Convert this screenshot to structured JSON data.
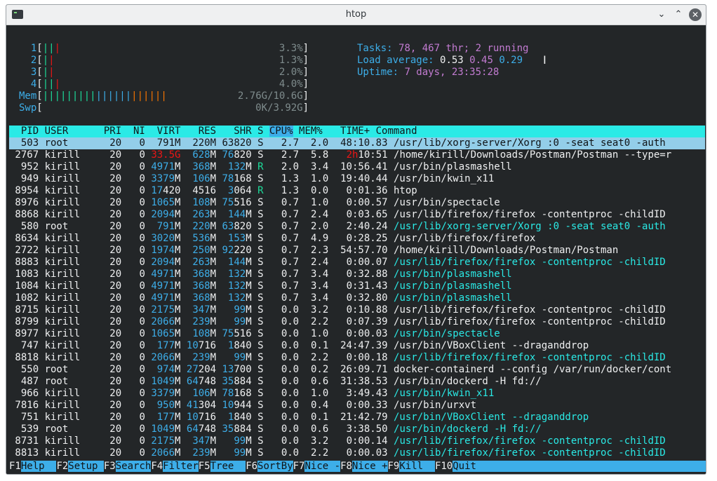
{
  "window": {
    "title": "htop"
  },
  "cpus": [
    {
      "label": "1",
      "pct": "3.3%"
    },
    {
      "label": "2",
      "pct": "1.3%"
    },
    {
      "label": "3",
      "pct": "2.0%"
    },
    {
      "label": "4",
      "pct": "4.0%"
    }
  ],
  "mem": {
    "label": "Mem",
    "value": "2.76G/10.6G"
  },
  "swp": {
    "label": "Swp",
    "value": "0K/3.92G"
  },
  "summary": {
    "tasks_label": "Tasks:",
    "tasks_value": "78, 467 thr; 2 running",
    "load_label": "Load average:",
    "load1": "0.53",
    "load5": "0.45",
    "load15": "0.29",
    "uptime_label": "Uptime:",
    "uptime_value": "7 days, 23:35:28"
  },
  "header": {
    "pid": "PID",
    "user": "USER",
    "pri": "PRI",
    "ni": "NI",
    "virt": "VIRT",
    "res": "RES",
    "shr": "SHR",
    "s": "S",
    "cpu": "CPU%",
    "mem": "MEM%",
    "time": "TIME+",
    "command": "Command"
  },
  "processes": [
    {
      "pid": "503",
      "user": "root",
      "pri": "20",
      "ni": "0",
      "virt": "791M",
      "res": "220M",
      "shr": "63820",
      "s": "S",
      "cpu": "2.7",
      "mem": "2.0",
      "time": "48:10.83",
      "cmd": "/usr/lib/xorg-server/Xorg :0 -seat seat0 -auth",
      "selected": true
    },
    {
      "pid": "2767",
      "user": "kirill",
      "pri": "20",
      "ni": "0",
      "virt": "33.5G",
      "res": "628M",
      "shr": "76820",
      "s": "S",
      "cpu": "2.7",
      "mem": "5.8",
      "time": "2h10:51",
      "cmd": "/home/kirill/Downloads/Postman/Postman --type=r"
    },
    {
      "pid": "952",
      "user": "kirill",
      "pri": "20",
      "ni": "0",
      "virt": "4971M",
      "res": "368M",
      "shr": "132M",
      "s": "R",
      "cpu": "2.0",
      "mem": "3.4",
      "time": "10:56.41",
      "cmd": "/usr/bin/plasmashell"
    },
    {
      "pid": "949",
      "user": "kirill",
      "pri": "20",
      "ni": "0",
      "virt": "3379M",
      "res": "106M",
      "shr": "78168",
      "s": "S",
      "cpu": "1.3",
      "mem": "1.0",
      "time": "19:40.44",
      "cmd": "/usr/bin/kwin_x11"
    },
    {
      "pid": "8954",
      "user": "kirill",
      "pri": "20",
      "ni": "0",
      "virt": "17420",
      "res": "4516",
      "shr": "3064",
      "s": "R",
      "cpu": "1.3",
      "mem": "0.0",
      "time": "0:01.36",
      "cmd": "htop"
    },
    {
      "pid": "8976",
      "user": "kirill",
      "pri": "20",
      "ni": "0",
      "virt": "1065M",
      "res": "108M",
      "shr": "75516",
      "s": "S",
      "cpu": "0.7",
      "mem": "1.0",
      "time": "0:00.57",
      "cmd": "/usr/bin/spectacle"
    },
    {
      "pid": "8868",
      "user": "kirill",
      "pri": "20",
      "ni": "0",
      "virt": "2094M",
      "res": "263M",
      "shr": "144M",
      "s": "S",
      "cpu": "0.7",
      "mem": "2.4",
      "time": "0:03.65",
      "cmd": "/usr/lib/firefox/firefox -contentproc -childID"
    },
    {
      "pid": "580",
      "user": "root",
      "pri": "20",
      "ni": "0",
      "virt": "791M",
      "res": "220M",
      "shr": "63820",
      "s": "S",
      "cpu": "0.7",
      "mem": "2.0",
      "time": "2:40.24",
      "cmd": "/usr/lib/xorg-server/Xorg :0 -seat seat0 -auth",
      "thread": true
    },
    {
      "pid": "8634",
      "user": "kirill",
      "pri": "20",
      "ni": "0",
      "virt": "3020M",
      "res": "536M",
      "shr": "153M",
      "s": "S",
      "cpu": "0.7",
      "mem": "4.9",
      "time": "0:28.25",
      "cmd": "/usr/lib/firefox/firefox"
    },
    {
      "pid": "2722",
      "user": "kirill",
      "pri": "20",
      "ni": "0",
      "virt": "1974M",
      "res": "250M",
      "shr": "92220",
      "s": "S",
      "cpu": "0.7",
      "mem": "2.3",
      "time": "54:57.70",
      "cmd": "/home/kirill/Downloads/Postman/Postman"
    },
    {
      "pid": "8883",
      "user": "kirill",
      "pri": "20",
      "ni": "0",
      "virt": "2094M",
      "res": "263M",
      "shr": "144M",
      "s": "S",
      "cpu": "0.7",
      "mem": "2.4",
      "time": "0:00.07",
      "cmd": "/usr/lib/firefox/firefox -contentproc -childID",
      "thread": true
    },
    {
      "pid": "1083",
      "user": "kirill",
      "pri": "20",
      "ni": "0",
      "virt": "4971M",
      "res": "368M",
      "shr": "132M",
      "s": "S",
      "cpu": "0.7",
      "mem": "3.4",
      "time": "0:32.88",
      "cmd": "/usr/bin/plasmashell",
      "thread": true
    },
    {
      "pid": "1084",
      "user": "kirill",
      "pri": "20",
      "ni": "0",
      "virt": "4971M",
      "res": "368M",
      "shr": "132M",
      "s": "S",
      "cpu": "0.7",
      "mem": "3.4",
      "time": "0:31.43",
      "cmd": "/usr/bin/plasmashell",
      "thread": true
    },
    {
      "pid": "1082",
      "user": "kirill",
      "pri": "20",
      "ni": "0",
      "virt": "4971M",
      "res": "368M",
      "shr": "132M",
      "s": "S",
      "cpu": "0.7",
      "mem": "3.4",
      "time": "0:32.80",
      "cmd": "/usr/bin/plasmashell",
      "thread": true
    },
    {
      "pid": "8715",
      "user": "kirill",
      "pri": "20",
      "ni": "0",
      "virt": "2175M",
      "res": "347M",
      "shr": "99M",
      "s": "S",
      "cpu": "0.0",
      "mem": "3.2",
      "time": "0:10.88",
      "cmd": "/usr/lib/firefox/firefox -contentproc -childID"
    },
    {
      "pid": "8799",
      "user": "kirill",
      "pri": "20",
      "ni": "0",
      "virt": "2066M",
      "res": "239M",
      "shr": "99M",
      "s": "S",
      "cpu": "0.0",
      "mem": "2.2",
      "time": "0:07.39",
      "cmd": "/usr/lib/firefox/firefox -contentproc -childID"
    },
    {
      "pid": "8977",
      "user": "kirill",
      "pri": "20",
      "ni": "0",
      "virt": "1065M",
      "res": "108M",
      "shr": "75516",
      "s": "S",
      "cpu": "0.0",
      "mem": "1.0",
      "time": "0:00.03",
      "cmd": "/usr/bin/spectacle",
      "thread": true
    },
    {
      "pid": "747",
      "user": "kirill",
      "pri": "20",
      "ni": "0",
      "virt": "177M",
      "res": "10716",
      "shr": "1840",
      "s": "S",
      "cpu": "0.0",
      "mem": "0.1",
      "time": "24:47.39",
      "cmd": "/usr/bin/VBoxClient --draganddrop"
    },
    {
      "pid": "8818",
      "user": "kirill",
      "pri": "20",
      "ni": "0",
      "virt": "2066M",
      "res": "239M",
      "shr": "99M",
      "s": "S",
      "cpu": "0.0",
      "mem": "2.2",
      "time": "0:00.18",
      "cmd": "/usr/lib/firefox/firefox -contentproc -childID",
      "thread": true
    },
    {
      "pid": "550",
      "user": "root",
      "pri": "20",
      "ni": "0",
      "virt": "974M",
      "res": "27204",
      "shr": "13700",
      "s": "S",
      "cpu": "0.0",
      "mem": "0.2",
      "time": "26:09.71",
      "cmd": "docker-containerd --config /var/run/docker/cont"
    },
    {
      "pid": "487",
      "user": "root",
      "pri": "20",
      "ni": "0",
      "virt": "1049M",
      "res": "64748",
      "shr": "35884",
      "s": "S",
      "cpu": "0.0",
      "mem": "0.6",
      "time": "31:38.53",
      "cmd": "/usr/bin/dockerd -H fd://"
    },
    {
      "pid": "966",
      "user": "kirill",
      "pri": "20",
      "ni": "0",
      "virt": "3379M",
      "res": "106M",
      "shr": "78168",
      "s": "S",
      "cpu": "0.0",
      "mem": "1.0",
      "time": "3:49.43",
      "cmd": "/usr/bin/kwin_x11",
      "thread": true
    },
    {
      "pid": "7816",
      "user": "kirill",
      "pri": "20",
      "ni": "0",
      "virt": "950M",
      "res": "41304",
      "shr": "10944",
      "s": "S",
      "cpu": "0.0",
      "mem": "0.4",
      "time": "0:00.33",
      "cmd": "/usr/bin/urxvt"
    },
    {
      "pid": "751",
      "user": "kirill",
      "pri": "20",
      "ni": "0",
      "virt": "177M",
      "res": "10716",
      "shr": "1840",
      "s": "S",
      "cpu": "0.0",
      "mem": "0.1",
      "time": "21:42.79",
      "cmd": "/usr/bin/VBoxClient --draganddrop",
      "thread": true
    },
    {
      "pid": "539",
      "user": "root",
      "pri": "20",
      "ni": "0",
      "virt": "1049M",
      "res": "64748",
      "shr": "35884",
      "s": "S",
      "cpu": "0.0",
      "mem": "0.6",
      "time": "3:38.50",
      "cmd": "/usr/bin/dockerd -H fd://",
      "thread": true
    },
    {
      "pid": "8731",
      "user": "kirill",
      "pri": "20",
      "ni": "0",
      "virt": "2175M",
      "res": "347M",
      "shr": "99M",
      "s": "S",
      "cpu": "0.0",
      "mem": "3.2",
      "time": "0:00.14",
      "cmd": "/usr/lib/firefox/firefox -contentproc -childID",
      "thread": true
    },
    {
      "pid": "8813",
      "user": "kirill",
      "pri": "20",
      "ni": "0",
      "virt": "2066M",
      "res": "239M",
      "shr": "99M",
      "s": "S",
      "cpu": "0.0",
      "mem": "2.2",
      "time": "0:00.03",
      "cmd": "/usr/lib/firefox/firefox -contentproc -childID",
      "thread": true
    }
  ],
  "footer": [
    {
      "key": "F1",
      "label": "Help  "
    },
    {
      "key": "F2",
      "label": "Setup "
    },
    {
      "key": "F3",
      "label": "Search"
    },
    {
      "key": "F4",
      "label": "Filter"
    },
    {
      "key": "F5",
      "label": "Tree  "
    },
    {
      "key": "F6",
      "label": "SortBy"
    },
    {
      "key": "F7",
      "label": "Nice -"
    },
    {
      "key": "F8",
      "label": "Nice +"
    },
    {
      "key": "F9",
      "label": "Kill  "
    },
    {
      "key": "F10",
      "label": "Quit  "
    }
  ],
  "colors": {
    "header_bg": "#2aeae6",
    "selected_bg": "#93cee9",
    "footer_label_bg": "#3daee9",
    "thread_text": "#2aeae6",
    "running_state": "#1cdc9a",
    "large_virt": "#ed1515"
  }
}
